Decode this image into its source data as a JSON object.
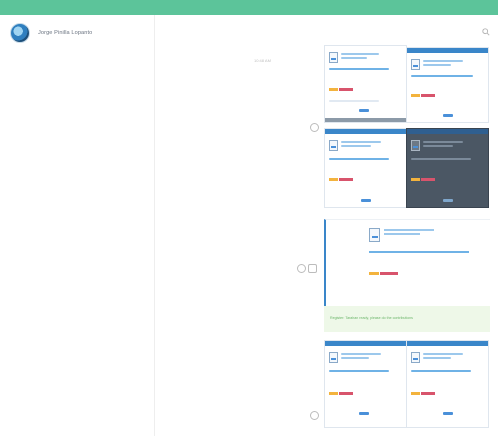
{
  "profile": {
    "name": "Jorge Pinilla Lopanto"
  },
  "conversation": {
    "time_label": "10:48 AM"
  },
  "banner": {
    "text": "Register: Tarahan ready, please do the contributions"
  },
  "colors": {
    "topbar": "#5cc49a",
    "accent": "#3a86c9",
    "banner_bg": "#eef8e8",
    "banner_text": "#6db66b"
  },
  "icons": {
    "search": "search-icon",
    "avatar": "globe-avatar"
  }
}
